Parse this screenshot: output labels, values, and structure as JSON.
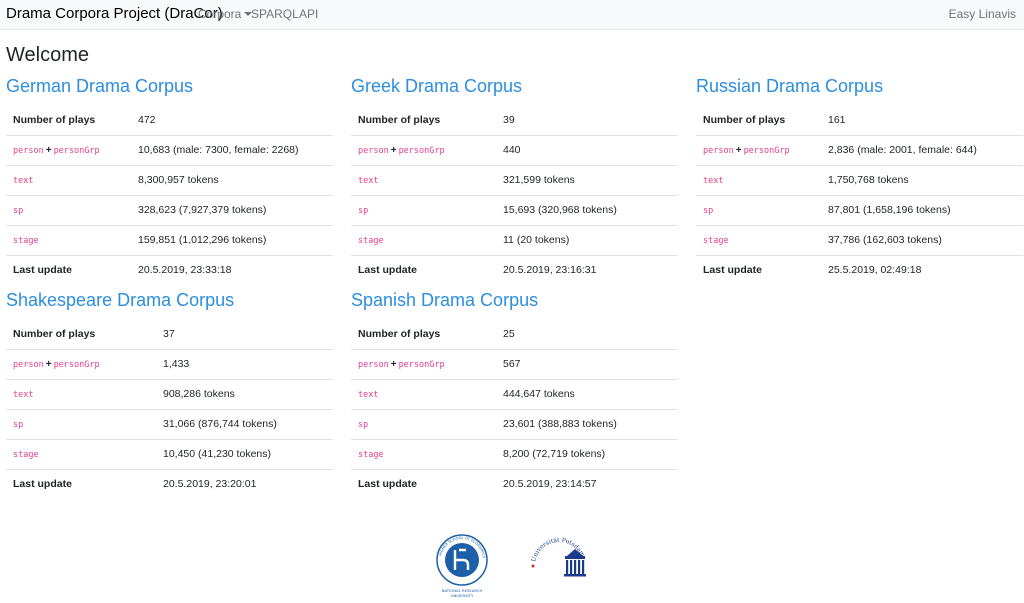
{
  "navbar": {
    "brand": "Drama Corpora Project (DraCor)",
    "links": {
      "corpora": "Corpora",
      "sparql": "SPARQL",
      "api": "API"
    },
    "right": "Easy Linavis"
  },
  "main": {
    "heading": "Welcome",
    "corpora": [
      {
        "title": "German Drama Corpus",
        "rows": {
          "plays_label": "Number of plays",
          "plays": "472",
          "person_code": "person",
          "persongrp_code": "personGrp",
          "plus": "+",
          "persons": "10,683 (male: 7300, female: 2268)",
          "text_code": "text",
          "text": "8,300,957 tokens",
          "sp_code": "sp",
          "sp": "328,623 (7,927,379 tokens)",
          "stage_code": "stage",
          "stage": "159,851 (1,012,296 tokens)",
          "update_label": "Last update",
          "update": "20.5.2019, 23:33:18"
        }
      },
      {
        "title": "Greek Drama Corpus",
        "rows": {
          "plays_label": "Number of plays",
          "plays": "39",
          "person_code": "person",
          "persongrp_code": "personGrp",
          "plus": "+",
          "persons": "440",
          "text_code": "text",
          "text": "321,599 tokens",
          "sp_code": "sp",
          "sp": "15,693 (320,968 tokens)",
          "stage_code": "stage",
          "stage": "11 (20 tokens)",
          "update_label": "Last update",
          "update": "20.5.2019, 23:16:31"
        }
      },
      {
        "title": "Russian Drama Corpus",
        "rows": {
          "plays_label": "Number of plays",
          "plays": "161",
          "person_code": "person",
          "persongrp_code": "personGrp",
          "plus": "+",
          "persons": "2,836 (male: 2001, female: 644)",
          "text_code": "text",
          "text": "1,750,768 tokens",
          "sp_code": "sp",
          "sp": "87,801 (1,658,196 tokens)",
          "stage_code": "stage",
          "stage": "37,786 (162,603 tokens)",
          "update_label": "Last update",
          "update": "25.5.2019, 02:49:18"
        }
      },
      {
        "title": "Shakespeare Drama Corpus",
        "rows": {
          "plays_label": "Number of plays",
          "plays": "37",
          "person_code": "person",
          "persongrp_code": "personGrp",
          "plus": "+",
          "persons": "1,433",
          "text_code": "text",
          "text": "908,286 tokens",
          "sp_code": "sp",
          "sp": "31,066 (876,744 tokens)",
          "stage_code": "stage",
          "stage": "10,450 (41,230 tokens)",
          "update_label": "Last update",
          "update": "20.5.2019, 23:20:01"
        }
      },
      {
        "title": "Spanish Drama Corpus",
        "rows": {
          "plays_label": "Number of plays",
          "plays": "25",
          "person_code": "person",
          "persongrp_code": "personGrp",
          "plus": "+",
          "persons": "567",
          "text_code": "text",
          "text": "444,647 tokens",
          "sp_code": "sp",
          "sp": "23,601 (388,883 tokens)",
          "stage_code": "stage",
          "stage": "8,200 (72,719 tokens)",
          "update_label": "Last update",
          "update": "20.5.2019, 23:14:57"
        }
      }
    ]
  },
  "footer": {
    "hse": {
      "caption_1": "NATIONAL RESEARCH",
      "caption_2": "UNIVERSITY",
      "ring_text": "HIGHER SCHOOL OF ECONOMICS"
    },
    "potsdam": {
      "ring_text": "Universität Potsdam"
    }
  },
  "colors": {
    "link": "#2b8ee0",
    "code": "#e83e8c",
    "navbar": "#f8f9fa",
    "hse_blue": "#1d5fa8",
    "potsdam_blue": "#1b3a8c"
  }
}
